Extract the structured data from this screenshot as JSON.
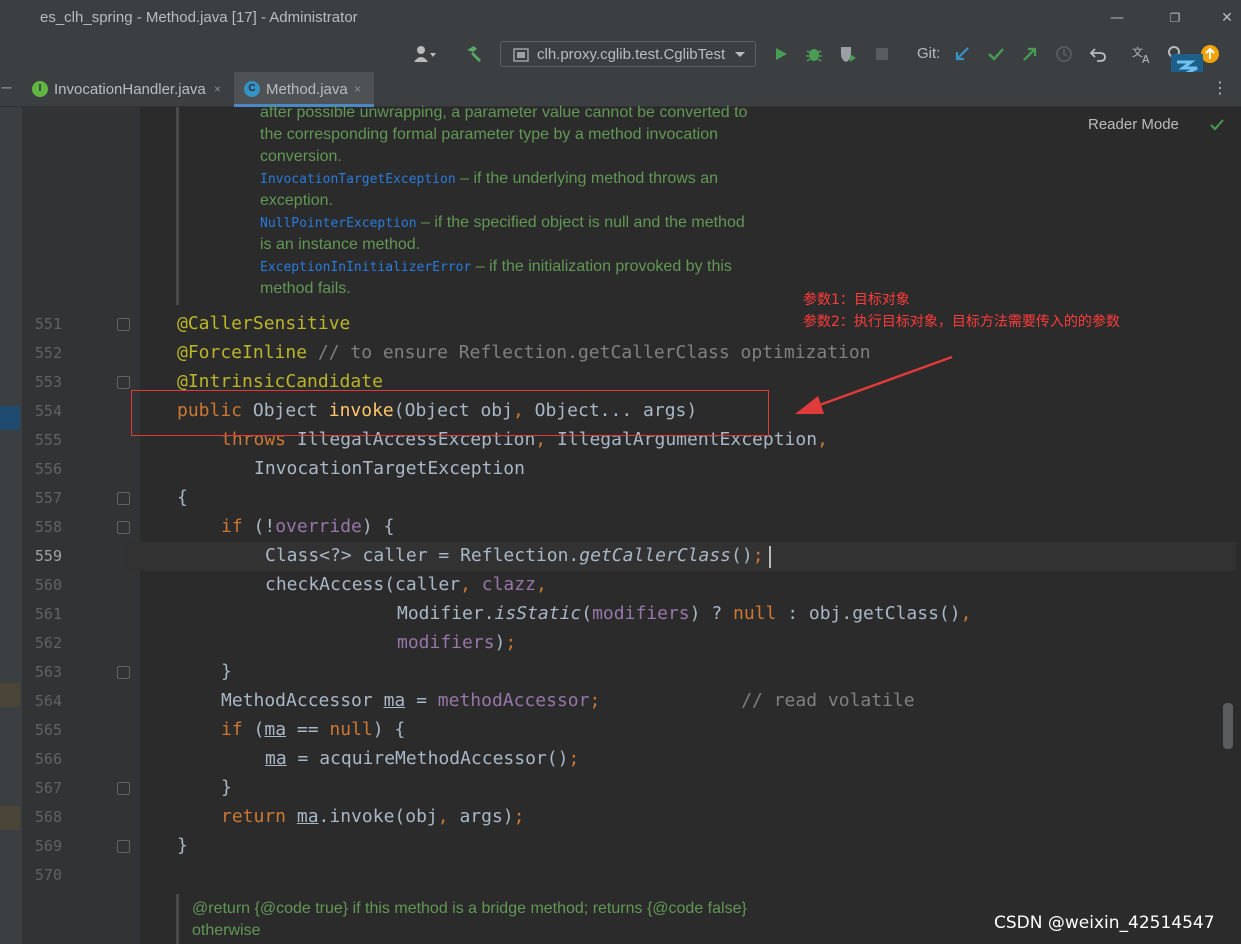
{
  "window": {
    "title": "es_clh_spring - Method.java [17] - Administrator",
    "minimize": "—",
    "restore": "❐",
    "close": "✕"
  },
  "toolbar": {
    "run_config": "clh.proxy.cglib.test.CglibTest",
    "git_label": "Git:",
    "icons": [
      "user-icon",
      "build-hammer-icon",
      "run-icon",
      "debug-bug-icon",
      "coverage-icon",
      "stop-icon",
      "git-update-icon",
      "git-commit-icon",
      "git-push-icon",
      "history-icon",
      "revert-icon",
      "translate-icon",
      "search-icon",
      "update-icon"
    ]
  },
  "tabs": [
    {
      "label": "InvocationHandler.java",
      "icon": "I",
      "close": "×"
    },
    {
      "label": "Method.java",
      "icon": "C",
      "close": "×"
    }
  ],
  "editor": {
    "reader_mode": "Reader Mode",
    "doc_top": [
      "after possible unwrapping, a parameter value cannot be converted to",
      "the corresponding formal parameter type by a method invocation",
      "conversion.",
      {
        "link": "InvocationTargetException",
        "text": " – if the underlying method throws an"
      },
      "exception.",
      {
        "link": "NullPointerException",
        "text": " – if the specified object is null and the method"
      },
      "is an instance method.",
      {
        "link": "ExceptionInInitializerError",
        "text": " – if the initialization provoked by this"
      },
      "method fails."
    ],
    "line_numbers": [
      "551",
      "552",
      "553",
      "554",
      "555",
      "556",
      "557",
      "558",
      "559",
      "560",
      "561",
      "562",
      "563",
      "564",
      "565",
      "566",
      "567",
      "568",
      "569",
      "570"
    ],
    "current_line": "559",
    "code": {
      "l551": "@CallerSensitive",
      "l552_a": "@ForceInline",
      "l552_c": " // to ensure Reflection.getCallerClass optimization",
      "l553": "@IntrinsicCandidate",
      "l554_k": "public",
      "l554_t": " Object ",
      "l554_m": "invoke",
      "l554_p": "(Object obj",
      "l554_comma": ",",
      "l554_r": " Object... args)",
      "l555_k": "throws",
      "l555_t": " IllegalAccessException",
      "l555_comma": ",",
      "l555_t2": " IllegalArgumentException",
      "l555_comma2": ",",
      "l556": "InvocationTargetException",
      "l557": "{",
      "l558_k": "if",
      "l558_p": " (!",
      "l558_f": "override",
      "l558_r": ") {",
      "l559_a": "Class<?> caller = Reflection.",
      "l559_i": "getCallerClass",
      "l559_b": "()",
      "l559_s": ";",
      "l560_a": "checkAccess(caller",
      "l560_c1": ",",
      "l560_f": " clazz",
      "l560_c2": ",",
      "l561_a": "Modifier.",
      "l561_i": "isStatic",
      "l561_b": "(",
      "l561_f": "modifiers",
      "l561_c": ") ? ",
      "l561_k": "null",
      "l561_d": " : obj.getClass()",
      "l561_e": ",",
      "l562_f": "modifiers",
      "l562_b": ")",
      "l562_s": ";",
      "l563": "}",
      "l564_a": "MethodAccessor ",
      "l564_u": "ma",
      "l564_b": " = ",
      "l564_f": "methodAccessor",
      "l564_s": ";",
      "l564_c": "             // read volatile",
      "l565_k": "if",
      "l565_a": " (",
      "l565_u": "ma",
      "l565_b": " == ",
      "l565_k2": "null",
      "l565_c": ") {",
      "l566_u": "ma",
      "l566_a": " = acquireMethodAccessor()",
      "l566_s": ";",
      "l567": "}",
      "l568_k": "return ",
      "l568_u": "ma",
      "l568_a": ".invoke(obj",
      "l568_c": ",",
      "l568_b": " args)",
      "l568_s": ";",
      "l569": "}"
    },
    "doc_bottom": [
      "@return {@code true} if this method is a bridge method; returns {@code false}",
      "otherwise"
    ]
  },
  "annotation": {
    "line1": "参数1：目标对象",
    "line2": "参数2：执行目标对象，目标方法需要传入的的参数",
    "box_color": "#e03a3a"
  },
  "watermark": "CSDN @weixin_42514547"
}
